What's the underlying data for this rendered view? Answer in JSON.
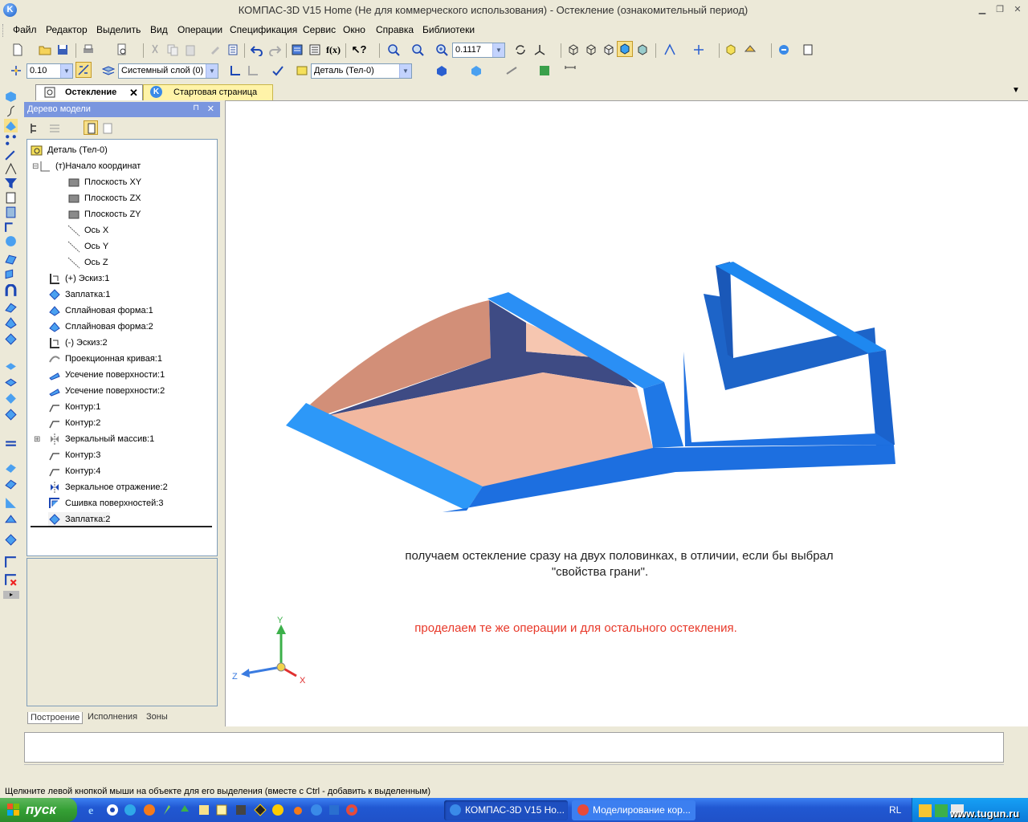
{
  "window": {
    "title": "КОМПАС-3D V15 Home (Не для коммерческого использования) - Остекление (ознакомительный период)"
  },
  "menu": [
    "Файл",
    "Редактор",
    "Выделить",
    "Вид",
    "Операции",
    "Спецификация",
    "Сервис",
    "Окно",
    "Справка",
    "Библиотеки"
  ],
  "toolbar1": {
    "zoom_value": "0.1117"
  },
  "toolbar2": {
    "step_value": "0.10",
    "layer_value": "Системный слой (0)",
    "part_value": "Деталь (Тел-0)"
  },
  "tabs": {
    "active": "Остекление",
    "start": "Стартовая страница"
  },
  "tree_panel": {
    "title": "Дерево модели",
    "items": [
      {
        "label": "Деталь (Тел-0)",
        "icon": "part-icon"
      },
      {
        "label": "(т)Начало координат",
        "icon": "origin-icon"
      },
      {
        "label": "Плоскость XY",
        "icon": "plane-icon"
      },
      {
        "label": "Плоскость ZX",
        "icon": "plane-icon"
      },
      {
        "label": "Плоскость ZY",
        "icon": "plane-icon"
      },
      {
        "label": "Ось X",
        "icon": "axis-icon"
      },
      {
        "label": "Ось Y",
        "icon": "axis-icon"
      },
      {
        "label": "Ось Z",
        "icon": "axis-icon"
      },
      {
        "label": "(+) Эскиз:1",
        "icon": "sketch-icon"
      },
      {
        "label": "Заплатка:1",
        "icon": "patch-icon"
      },
      {
        "label": "Сплайновая форма:1",
        "icon": "spline-icon"
      },
      {
        "label": "Сплайновая форма:2",
        "icon": "spline-icon"
      },
      {
        "label": "(-) Эскиз:2",
        "icon": "sketch-icon"
      },
      {
        "label": "Проекционная кривая:1",
        "icon": "curve-icon"
      },
      {
        "label": "Усечение поверхности:1",
        "icon": "trim-icon"
      },
      {
        "label": "Усечение поверхности:2",
        "icon": "trim-icon"
      },
      {
        "label": "Контур:1",
        "icon": "contour-icon"
      },
      {
        "label": "Контур:2",
        "icon": "contour-icon"
      },
      {
        "label": "Зеркальный массив:1",
        "icon": "mirror-array-icon"
      },
      {
        "label": "Контур:3",
        "icon": "contour-icon"
      },
      {
        "label": "Контур:4",
        "icon": "contour-icon"
      },
      {
        "label": "Зеркальное отражение:2",
        "icon": "mirror-icon"
      },
      {
        "label": "Сшивка поверхностей:3",
        "icon": "stitch-icon"
      },
      {
        "label": "Заплатка:2",
        "icon": "patch-icon"
      }
    ],
    "bottom_tabs": [
      "Построение",
      "Исполнения",
      "Зоны"
    ]
  },
  "viewport": {
    "note1_line1": "получаем остекление сразу на двух половинках, в отличии, если бы выбрал",
    "note1_line2": "\"свойства грани\".",
    "note2": "проделаем те же операции и для остального остекления.",
    "axis_x": "X",
    "axis_y": "Y",
    "axis_z": "Z",
    "colors": {
      "note2": "#e8392a",
      "frame_blue": "#1e7fe8",
      "glass_pink": "#f2b8a0"
    }
  },
  "status": {
    "hint": "Щелкните левой кнопкой мыши на объекте для его выделения (вместе с Ctrl - добавить к выделенным)"
  },
  "taskbar": {
    "start": "пуск",
    "task1": "КОМПАС-3D V15 Ho...",
    "task2": "Моделирование кор...",
    "lang": "RL",
    "watermark": "www.tugun.ru"
  }
}
